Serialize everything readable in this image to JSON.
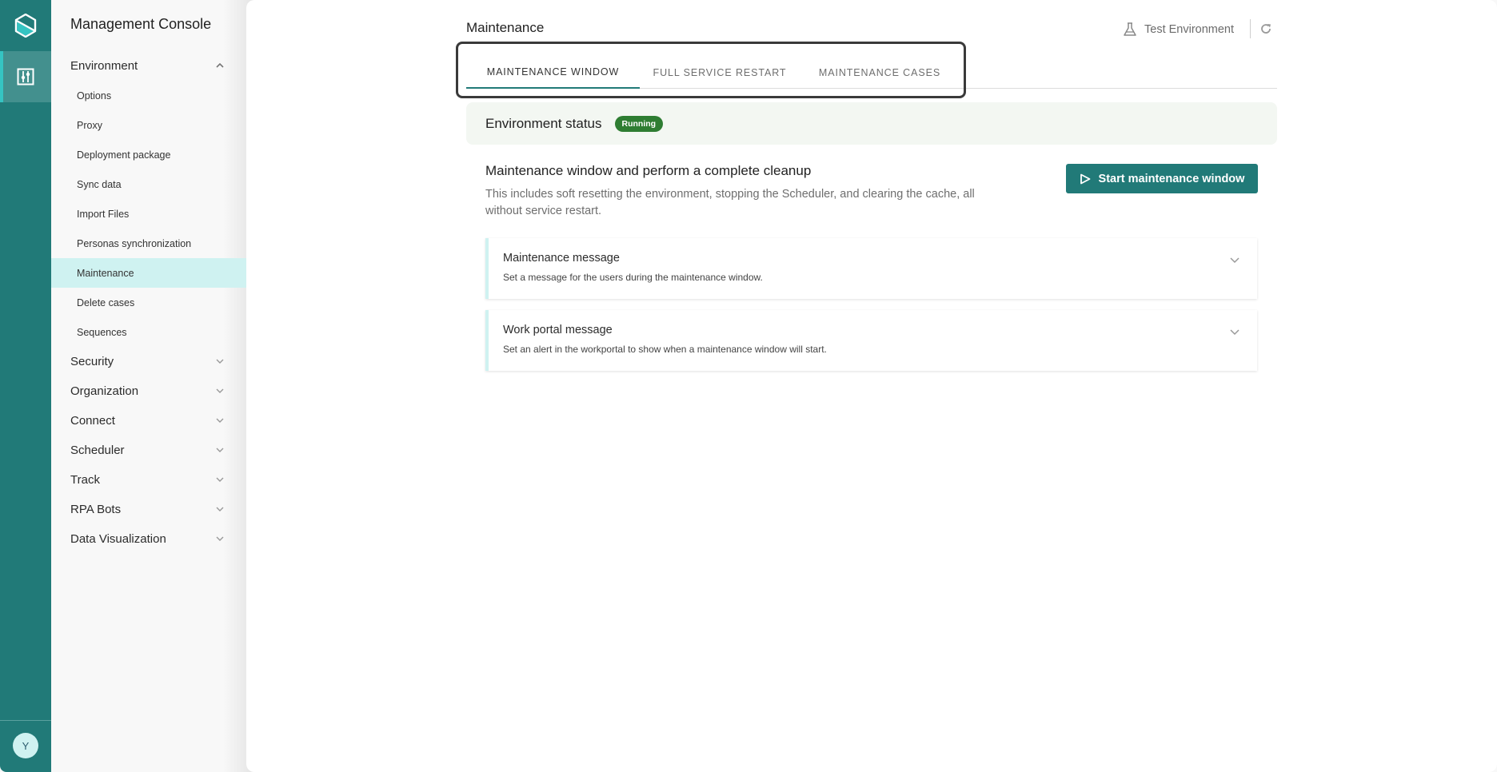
{
  "rail": {
    "logo_icon": "hexagon-logo-icon",
    "active_item_icon": "sliders-icon",
    "avatar_initial": "Y",
    "accent_color": "#217a78",
    "active_accent_color": "#35c4c2"
  },
  "nav": {
    "title": "Management Console",
    "expanded_group": {
      "label": "Environment",
      "items": [
        {
          "label": "Options"
        },
        {
          "label": "Proxy"
        },
        {
          "label": "Deployment package"
        },
        {
          "label": "Sync data"
        },
        {
          "label": "Import Files"
        },
        {
          "label": "Personas synchronization"
        },
        {
          "label": "Maintenance",
          "active": true
        },
        {
          "label": "Delete cases"
        },
        {
          "label": "Sequences"
        }
      ]
    },
    "groups": [
      {
        "label": "Security"
      },
      {
        "label": "Organization"
      },
      {
        "label": "Connect"
      },
      {
        "label": "Scheduler"
      },
      {
        "label": "Track"
      },
      {
        "label": "RPA Bots"
      },
      {
        "label": "Data Visualization"
      }
    ]
  },
  "header": {
    "title": "Maintenance",
    "environment_label": "Test Environment",
    "environment_icon": "flask-icon",
    "refresh_icon": "refresh-icon"
  },
  "tabs": [
    {
      "label": "MAINTENANCE WINDOW",
      "active": true
    },
    {
      "label": "FULL SERVICE RESTART",
      "active": false
    },
    {
      "label": "MAINTENANCE CASES",
      "active": false
    }
  ],
  "status": {
    "label": "Environment status",
    "badge": "Running",
    "badge_color": "#2e7d32"
  },
  "section": {
    "title": "Maintenance window and perform a complete cleanup",
    "description": "This includes soft resetting the environment, stopping the Scheduler, and clearing the cache, all without service restart.",
    "button_label": "Start maintenance window",
    "button_icon": "play-icon"
  },
  "cards": [
    {
      "title": "Maintenance message",
      "description": "Set a message for the users during the maintenance window."
    },
    {
      "title": "Work portal message",
      "description": "Set an alert in the workportal to show when a maintenance window will start."
    }
  ]
}
